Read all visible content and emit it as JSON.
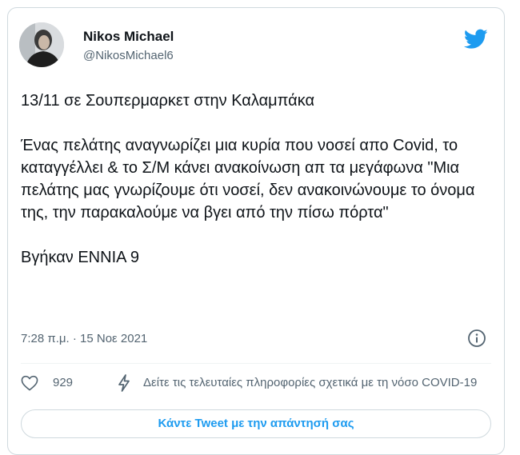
{
  "tweet": {
    "author_name": "Nikos Michael",
    "author_handle": "@NikosMichael6",
    "body_line1": "13/11 σε Σουπερμαρκετ στην Καλαμπάκα",
    "body_para2": "Ένας πελάτης αναγνωρίζει μια κυρία που νοσεί απο Covid, το καταγγέλλει & το Σ/Μ κάνει ανακοίνωση απ τα μεγάφωνα \"Μια πελάτης μας γνωρίζουμε ότι νοσεί, δεν ανακοινώνουμε το όνομα της, την παρακαλούμε να βγει από την πίσω πόρτα\"",
    "body_para3": "Βγήκαν ΕΝΝΙΑ 9",
    "timestamp": "7:28 π.μ. · 15 Νοε 2021",
    "like_count": "929",
    "info_link": "Δείτε τις τελευταίες πληροφορίες σχετικά με τη νόσο COVID-19",
    "reply_button": "Κάντε Tweet με την απάντησή σας"
  },
  "icons": {
    "brand": "twitter-bird-icon",
    "info": "info-icon",
    "like": "heart-icon",
    "covid_info": "lightning-share-icon"
  },
  "colors": {
    "brand_blue": "#1d9bf0",
    "text_primary": "#0f1419",
    "text_secondary": "#536471",
    "border": "#cfd9de"
  }
}
